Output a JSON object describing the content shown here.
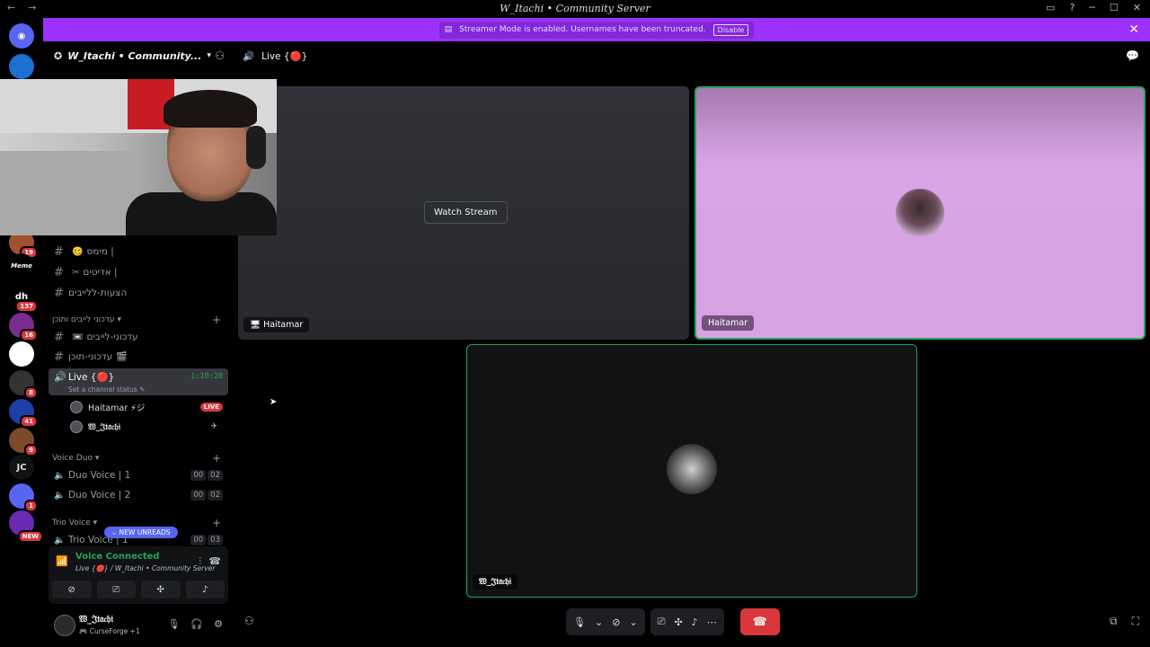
{
  "window": {
    "title": "W_Itachi • Community Server",
    "nav_back": "←",
    "nav_forward": "→",
    "right_icons": [
      "inbox-icon",
      "help-icon",
      "minimize-icon",
      "maximize-icon",
      "close-icon"
    ]
  },
  "banner": {
    "text": "Streamer Mode is enabled. Usernames have been truncated.",
    "button": "Disable"
  },
  "rail": {
    "items": [
      {
        "label": "",
        "color": "#5865f2",
        "badge": ""
      },
      {
        "label": "",
        "color": "#1d6fd1",
        "badge": ""
      },
      {
        "label": "",
        "color": "#a0522d",
        "badge": "19"
      },
      {
        "label": "Meme",
        "color": "#000000",
        "badge": ""
      },
      {
        "label": "dh",
        "color": "#000000",
        "badge": "137"
      },
      {
        "label": "",
        "color": "#7b2d8f",
        "badge": "16"
      },
      {
        "label": "",
        "color": "#ffffff",
        "badge": ""
      },
      {
        "label": "",
        "color": "#333333",
        "badge": "8"
      },
      {
        "label": "",
        "color": "#1d3fa8",
        "badge": "41"
      },
      {
        "label": "",
        "color": "#7a4b2a",
        "badge": "9"
      },
      {
        "label": "JC",
        "color": "#111214",
        "badge": ""
      },
      {
        "label": "",
        "color": "#5865f2",
        "badge": "1"
      },
      {
        "label": "",
        "color": "#6c2ab3",
        "badge": "NEW"
      }
    ]
  },
  "sidebar": {
    "server_name": "W_Itachi • Community...",
    "channels": [
      {
        "name": "מימס |",
        "emoji": "🥴"
      },
      {
        "name": "אדיטים |",
        "emoji": "✂"
      },
      {
        "name": "הצעות-ללייבים",
        "emoji": ""
      }
    ],
    "category_updates": "עדכוני לייבים ותוכן",
    "update_channels": [
      {
        "name": "עדכוני-לייבים",
        "emoji": "📼"
      },
      {
        "name": "עדכוני-תוכן",
        "emoji": "🎬"
      }
    ],
    "live_channel": {
      "name": "Live {🔴}",
      "status": "Set a channel status ✎",
      "timer": "1:10:20"
    },
    "voice_users": [
      {
        "name": "Haitamar ⚡ジ",
        "badge": "LIVE"
      },
      {
        "name": "𝔚_𝔍𝔱𝔞𝔠𝔥𝔦",
        "badge": ""
      }
    ],
    "category_duo": "Voice Duo",
    "duo_channels": [
      {
        "name": "Duo Voice | 1",
        "count": "00",
        "max": "02"
      },
      {
        "name": "Duo Voice | 2",
        "count": "00",
        "max": "02"
      }
    ],
    "category_trio": "Trio Voice",
    "trio_channel": {
      "name": "Trio Voice | 1",
      "count": "00",
      "max": "03"
    },
    "new_unreads": "NEW UNREADS"
  },
  "voice_panel": {
    "title": "Voice Connected",
    "subtitle": "Live {🔴} / W_Itachi • Community Server"
  },
  "user_panel": {
    "name": "𝔚_𝔍𝔱𝔞𝔠𝔥𝔦",
    "status": "CurseForge +1"
  },
  "main": {
    "channel_title": "Live {🔴}",
    "tiles": [
      {
        "label": "Haitamar",
        "action": "Watch Stream"
      },
      {
        "label": "Haitamar"
      },
      {
        "label": "𝔚_𝔍𝔱𝔞𝔠𝔥𝔦"
      }
    ]
  },
  "colors": {
    "brand": "#5865f2",
    "banner": "#9b30ff",
    "voice_green": "#23a55a",
    "danger": "#da373c"
  }
}
